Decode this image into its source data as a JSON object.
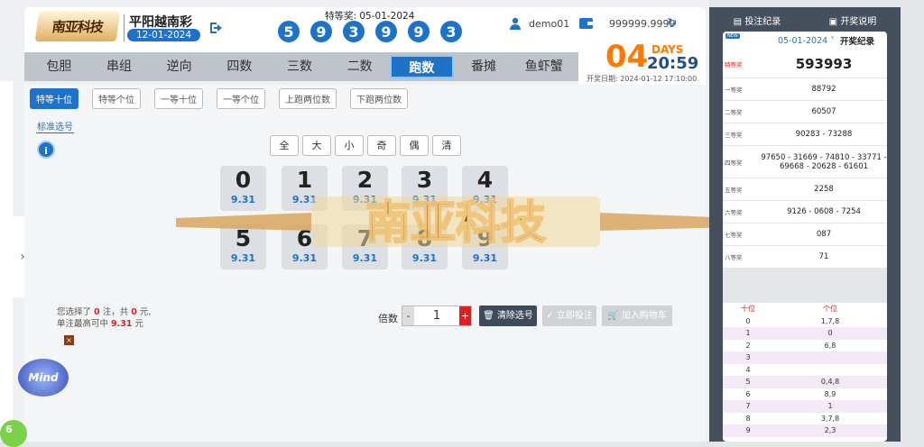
{
  "header": {
    "logo_text": "南亚科技",
    "lottery_name": "平阳越南彩",
    "lottery_date": "12-01-2024",
    "special_label": "特等奖: 05-01-2024",
    "special_balls": [
      "5",
      "9",
      "3",
      "9",
      "9",
      "3"
    ],
    "username": "demo01",
    "balance": "999999.9999",
    "icons": {
      "exit": "exit-icon",
      "user": "user-icon",
      "wallet": "wallet-icon",
      "refresh": "refresh-icon"
    }
  },
  "tabs": [
    "包胆",
    "串组",
    "逆向",
    "四数",
    "三数",
    "二数",
    "跑数",
    "番摊",
    "鱼虾蟹"
  ],
  "active_tab": "跑数",
  "countdown": {
    "days": "04",
    "days_label": "DAYS",
    "time": "20:59",
    "open_date": "开奖日期: 2024-01-12 17:10:00"
  },
  "subtabs": [
    "特等十位",
    "特等个位",
    "一等十位",
    "一等个位",
    "上跑两位数",
    "下跑两位数"
  ],
  "standard_link": "标准选号",
  "filters": [
    "全",
    "大",
    "小",
    "奇",
    "偶",
    "清"
  ],
  "digits": [
    {
      "n": "0",
      "odds": "9.31"
    },
    {
      "n": "1",
      "odds": "9.31"
    },
    {
      "n": "2",
      "odds": "9.31"
    },
    {
      "n": "3",
      "odds": "9.31"
    },
    {
      "n": "4",
      "odds": "9.31"
    },
    {
      "n": "5",
      "odds": "9.31"
    },
    {
      "n": "6",
      "odds": "9.31"
    },
    {
      "n": "7",
      "odds": "9.31"
    },
    {
      "n": "8",
      "odds": "9.31"
    },
    {
      "n": "9",
      "odds": "9.31"
    }
  ],
  "summary": {
    "line1_a": "您选择了",
    "count": "0",
    "line1_b": "注，共",
    "amount": "0",
    "line1_c": "元,",
    "line2_a": "单注最高可中",
    "max": "9.31",
    "line2_b": "元"
  },
  "multiplier": {
    "label": "倍数",
    "value": "1",
    "minus": "-",
    "plus": "+"
  },
  "buttons": {
    "clear": "清除选号",
    "bet": "立即投注",
    "cart": "加入购物车"
  },
  "watermark": "南亚科技",
  "badge_text": "Mind",
  "corner_ball": "6",
  "right_panel": {
    "bet_record": "投注纪录",
    "draw_info": "开奖说明",
    "new_tag": "NEW",
    "date": "05-01-2024",
    "title": "开奖纪录",
    "prizes": [
      {
        "label": "特等奖",
        "value": "593993"
      },
      {
        "label": "一等奖",
        "value": "88792"
      },
      {
        "label": "二等奖",
        "value": "60507"
      },
      {
        "label": "三等奖",
        "value": "90283 - 73288"
      },
      {
        "label": "四等奖",
        "value": "97650 - 31669 - 74810 - 33771 - 69668 - 20628 - 61601"
      },
      {
        "label": "五等奖",
        "value": "2258"
      },
      {
        "label": "六等奖",
        "value": "9126 - 0608 - 7254"
      },
      {
        "label": "七等奖",
        "value": "087"
      },
      {
        "label": "八等奖",
        "value": "71"
      }
    ],
    "tail_headers": [
      "十位",
      "个位"
    ],
    "tails": [
      {
        "d": "0",
        "v": "1,7,8"
      },
      {
        "d": "1",
        "v": "0"
      },
      {
        "d": "2",
        "v": "6,8"
      },
      {
        "d": "3",
        "v": ""
      },
      {
        "d": "4",
        "v": ""
      },
      {
        "d": "5",
        "v": "0,4,8"
      },
      {
        "d": "6",
        "v": "8,9"
      },
      {
        "d": "7",
        "v": "1"
      },
      {
        "d": "8",
        "v": "3,7,8"
      },
      {
        "d": "9",
        "v": "2,3"
      }
    ],
    "tail_colors": [
      "#ffffff",
      "#f3e9f7",
      "#ffffff",
      "#f3e9f7",
      "#ffffff",
      "#f3e9f7",
      "#ffffff",
      "#f3e9f7",
      "#ffffff",
      "#f3e9f7"
    ]
  }
}
